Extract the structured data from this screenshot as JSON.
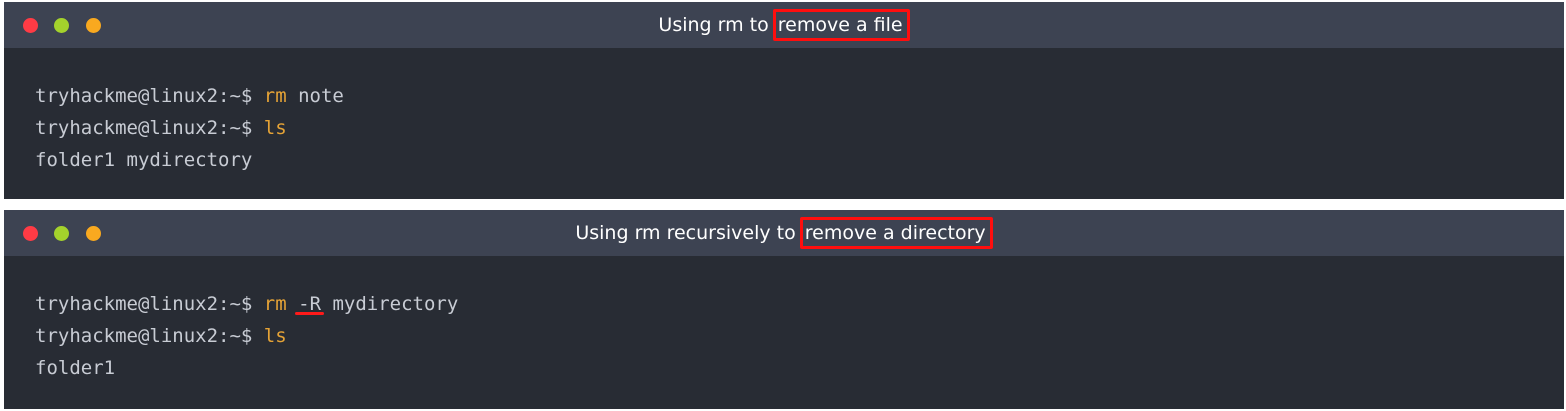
{
  "windows": [
    {
      "title_plain": "Using rm to ",
      "title_highlight": "remove a file",
      "lines": [
        {
          "prompt": "tryhackme@linux2:~$ ",
          "cmd": "rm",
          "args": " note"
        },
        {
          "prompt": "tryhackme@linux2:~$ ",
          "cmd": "ls",
          "args": ""
        },
        {
          "output": "folder1 mydirectory"
        }
      ]
    },
    {
      "title_plain": "Using rm recursively to ",
      "title_highlight": "remove a directory",
      "lines": [
        {
          "prompt": "tryhackme@linux2:~$ ",
          "cmd": "rm",
          "flag": "-R",
          "args": " mydirectory"
        },
        {
          "prompt": "tryhackme@linux2:~$ ",
          "cmd": "ls",
          "args": ""
        },
        {
          "output": "folder1"
        }
      ]
    }
  ],
  "colors": {
    "terminal_bg": "#282c34",
    "titlebar_bg": "#3d4352",
    "command": "#e5a336",
    "text": "#c8ccd4",
    "highlight": "#ff0e0e",
    "light_red": "#ff3b45",
    "light_yellow": "#a4d22c",
    "light_green": "#f9a91f"
  }
}
